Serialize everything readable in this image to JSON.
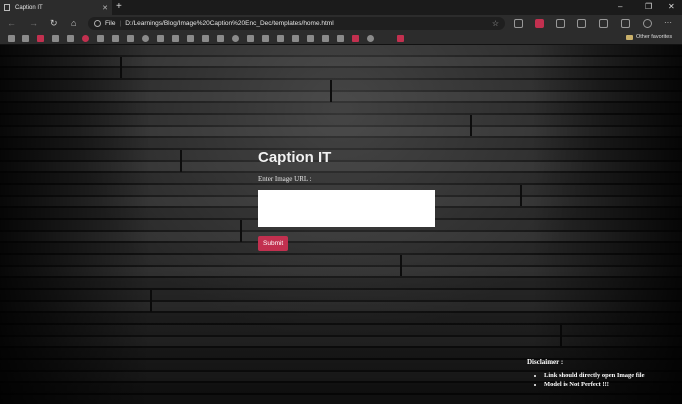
{
  "browser": {
    "tab": {
      "title": "Caption IT",
      "close": "✕"
    },
    "new_tab": "+",
    "window_controls": [
      "–",
      "❐",
      "✕"
    ],
    "nav": {
      "back": "←",
      "forward": "→",
      "reload": "↻",
      "home": "⌂"
    },
    "address": {
      "scheme": "File",
      "separator": "|",
      "url": "D:/Learnings/Blog/Image%20Caption%20Enc_Dec/templates/home.html"
    },
    "more": "···",
    "favorites": {
      "other_label": "Other favorites"
    }
  },
  "page": {
    "title": "Caption IT",
    "url_label": "Enter Image URL :",
    "url_input": {
      "value": "",
      "placeholder": ""
    },
    "submit_label": "Submit",
    "disclaimer": {
      "heading": "Disclaimer :",
      "items": [
        "Link should directly open Image file",
        "Model is Not Perfect !!!"
      ]
    }
  },
  "colors": {
    "accent": "#c2304f",
    "chrome": "#2c2c2c",
    "tabbar": "#1b1b1b"
  }
}
